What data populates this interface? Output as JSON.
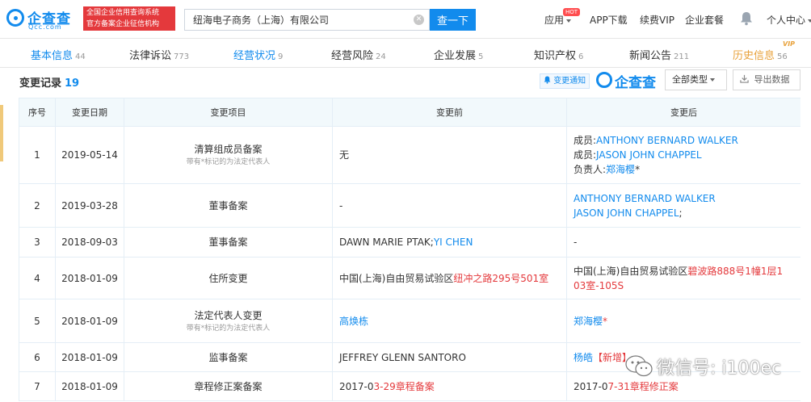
{
  "header": {
    "logo_name": "企查查",
    "logo_domain": "Qcc.com",
    "badge_line1": "全国企业信用查询系统",
    "badge_line2": "官方备案企业征信机构",
    "search_value": "纽海电子商务（上海）有限公司",
    "search_button": "查一下",
    "nav_app": "应用",
    "hot_badge": "HOT",
    "nav_download": "APP下载",
    "nav_vip": "续费VIP",
    "nav_package": "企业套餐",
    "nav_user": "个人中心"
  },
  "tabs": [
    {
      "label": "基本信息",
      "count": "44"
    },
    {
      "label": "法律诉讼",
      "count": "773"
    },
    {
      "label": "经营状况",
      "count": "9"
    },
    {
      "label": "经营风险",
      "count": "24"
    },
    {
      "label": "企业发展",
      "count": "5"
    },
    {
      "label": "知识产权",
      "count": "6"
    },
    {
      "label": "新闻公告",
      "count": "211"
    },
    {
      "label": "历史信息",
      "count": "56"
    }
  ],
  "vip_tag": "VIP",
  "section": {
    "title": "变更记录",
    "count": "19",
    "notify_label": "变更通知",
    "qcc_logo_text": "企查查",
    "type_select": "全部类型",
    "export_label": "导出数据"
  },
  "table": {
    "headers": [
      "序号",
      "变更日期",
      "变更项目",
      "变更前",
      "变更后"
    ],
    "note": "带有*标记的为法定代表人",
    "rows": [
      {
        "no": "1",
        "date": "2019-05-14",
        "item": "清算组成员备案"
      },
      {
        "no": "2",
        "date": "2019-03-28",
        "item": "董事备案"
      },
      {
        "no": "3",
        "date": "2018-09-03",
        "item": "董事备案"
      },
      {
        "no": "4",
        "date": "2018-01-09",
        "item": "住所变更"
      },
      {
        "no": "5",
        "date": "2018-01-09",
        "item": "法定代表人变更"
      },
      {
        "no": "6",
        "date": "2018-01-09",
        "item": "监事备案"
      },
      {
        "no": "7",
        "date": "2018-01-09",
        "item": "章程修正案备案"
      }
    ],
    "r1": {
      "before": "无",
      "after1_prefix": "成员:",
      "after1_name": "ANTHONY BERNARD WALKER",
      "after2_prefix": "成员:",
      "after2_name": "JASON JOHN CHAPPEL",
      "after3_prefix": "负责人:",
      "after3_name": "郑海樱",
      "after3_star": "*"
    },
    "r2": {
      "before": "-",
      "after1": "ANTHONY BERNARD WALKER",
      "after2": "JASON JOHN CHAPPEL",
      "after2_suffix": ";"
    },
    "r3": {
      "before_a": "DAWN MARIE PTAK;",
      "before_b": "YI CHEN",
      "after": "-"
    },
    "r4": {
      "before_a": "中国(上海)自由贸易试验区",
      "before_b": "纽冲之路295号501室",
      "after_a": "中国(上海)自由贸易试验区",
      "after_b": "碧波路888号1幢1层1",
      "after_c": "03室-105S"
    },
    "r5": {
      "before": "高焕栋",
      "after": "郑海樱",
      "after_star": "*"
    },
    "r6": {
      "before": "JEFFREY GLENN SANTORO",
      "after_a": "杨皓",
      "after_b": "【新增】"
    },
    "r7": {
      "before_a": "2017-0",
      "before_b": "3-29",
      "before_c": "章程备案",
      "after_a": "2017-0",
      "after_b": "7-31",
      "after_c": "章程修正案"
    }
  },
  "watermark": {
    "text": "微信号: i100ec"
  },
  "colors": {
    "brand": "#128bed",
    "highlight": "#e4393c",
    "history": "#e8a13a",
    "header_bg": "#f2f9fc"
  }
}
